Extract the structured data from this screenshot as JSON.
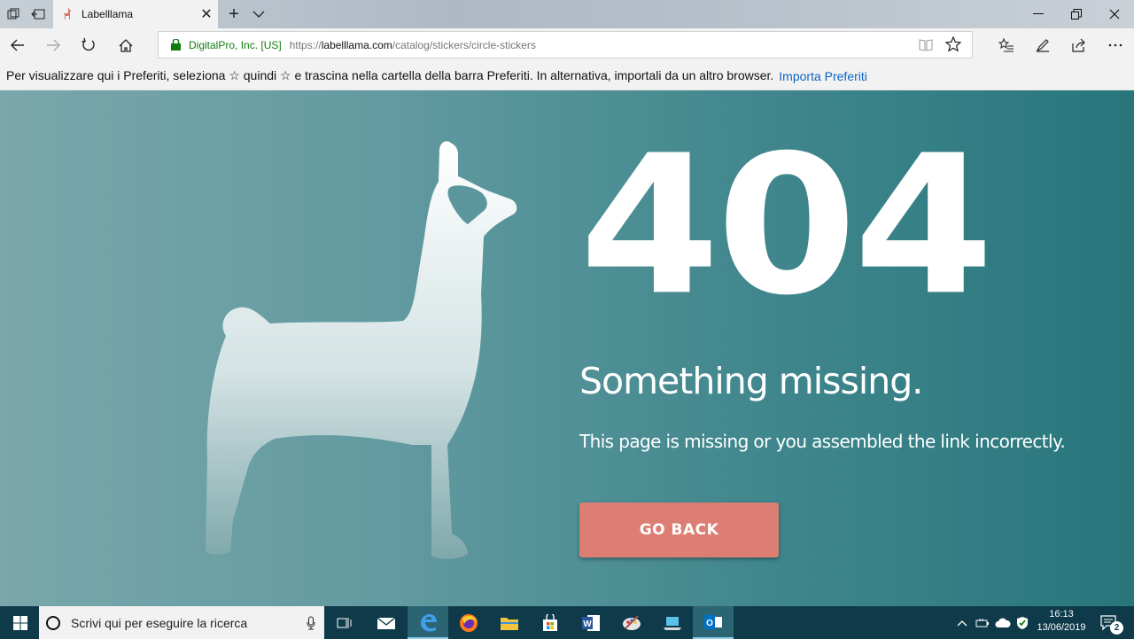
{
  "browser": {
    "tab_title": "Labelllama",
    "tab_close": "✕",
    "new_tab": "+",
    "address": {
      "cert_label": "DigitalPro, Inc. [US]",
      "url_prefix": "https://",
      "url_host": "labelllama.com",
      "url_path": "/catalog/stickers/circle-stickers"
    },
    "favorites_bar": {
      "message": "Per visualizzare qui i Preferiti, seleziona  ☆  quindi ☆ e trascina nella cartella della barra Preferiti. In alternativa, importali da un altro browser.",
      "import_link": "Importa Preferiti"
    }
  },
  "page": {
    "code": "404",
    "headline": "Something missing.",
    "message": "This page is missing or you assembled the link incorrectly.",
    "button_label": "GO BACK",
    "colors": {
      "bg_left": "#79a7ab",
      "bg_right": "#27767c",
      "button": "#dc7e73"
    }
  },
  "taskbar": {
    "search_placeholder": "Scrivi qui per eseguire la ricerca",
    "time": "16:13",
    "date": "13/06/2019",
    "notification_count": "2",
    "apps": [
      "windows-start-icon",
      "task-view-icon",
      "mail-icon",
      "edge-icon",
      "firefox-icon",
      "file-explorer-icon",
      "store-icon",
      "word-icon",
      "paint-icon",
      "laptop-icon",
      "outlook-icon"
    ]
  }
}
